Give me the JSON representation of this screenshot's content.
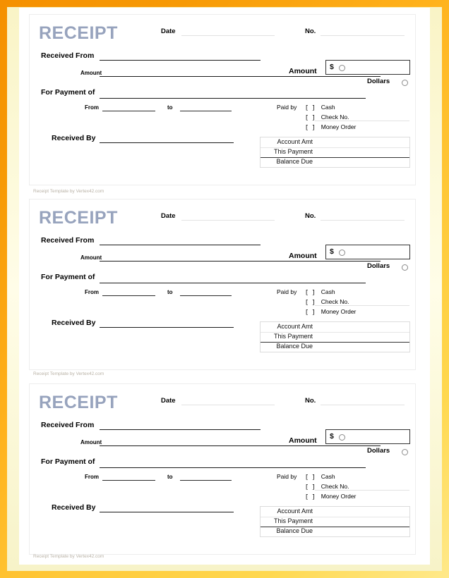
{
  "document": {
    "type": "receipt-template",
    "page_count": 1,
    "receipt_count": 3,
    "frame_color": "#f59000",
    "frame_color_light": "#ffe98a",
    "title_color": "#97a3bd",
    "paper_color": "#ffffff"
  },
  "receipt": {
    "title": "RECEIPT",
    "date_label": "Date",
    "no_label": "No.",
    "received_from_label": "Received From",
    "amount_words_label": "Amount",
    "amount_box_label": "Amount",
    "currency_symbol": "$",
    "dollars_label": "Dollars",
    "for_payment_of_label": "For Payment of",
    "from_label": "From",
    "to_label": "to",
    "received_by_label": "Received By",
    "paid_by_label": "Paid by",
    "payment_methods": [
      {
        "checkbox": "[ ]",
        "label": "Cash"
      },
      {
        "checkbox": "[ ]",
        "label": "Check No."
      },
      {
        "checkbox": "[ ]",
        "label": "Money Order"
      }
    ],
    "account_table": {
      "rows": [
        {
          "label": "Account Amt",
          "value": ""
        },
        {
          "label": "This Payment",
          "value": ""
        },
        {
          "label": "Balance Due",
          "value": ""
        }
      ]
    },
    "credit": "Receipt Template by Vertex42.com",
    "icons": {
      "amount_spinner": "spinner-circle-icon",
      "dollars_spinner": "spinner-circle-icon"
    }
  },
  "fields": {
    "date_value": "",
    "no_value": "",
    "received_from_value": "",
    "amount_words_value": "",
    "amount_value": "",
    "for_payment_of_value": "",
    "from_value": "",
    "to_value": "",
    "received_by_value": ""
  }
}
